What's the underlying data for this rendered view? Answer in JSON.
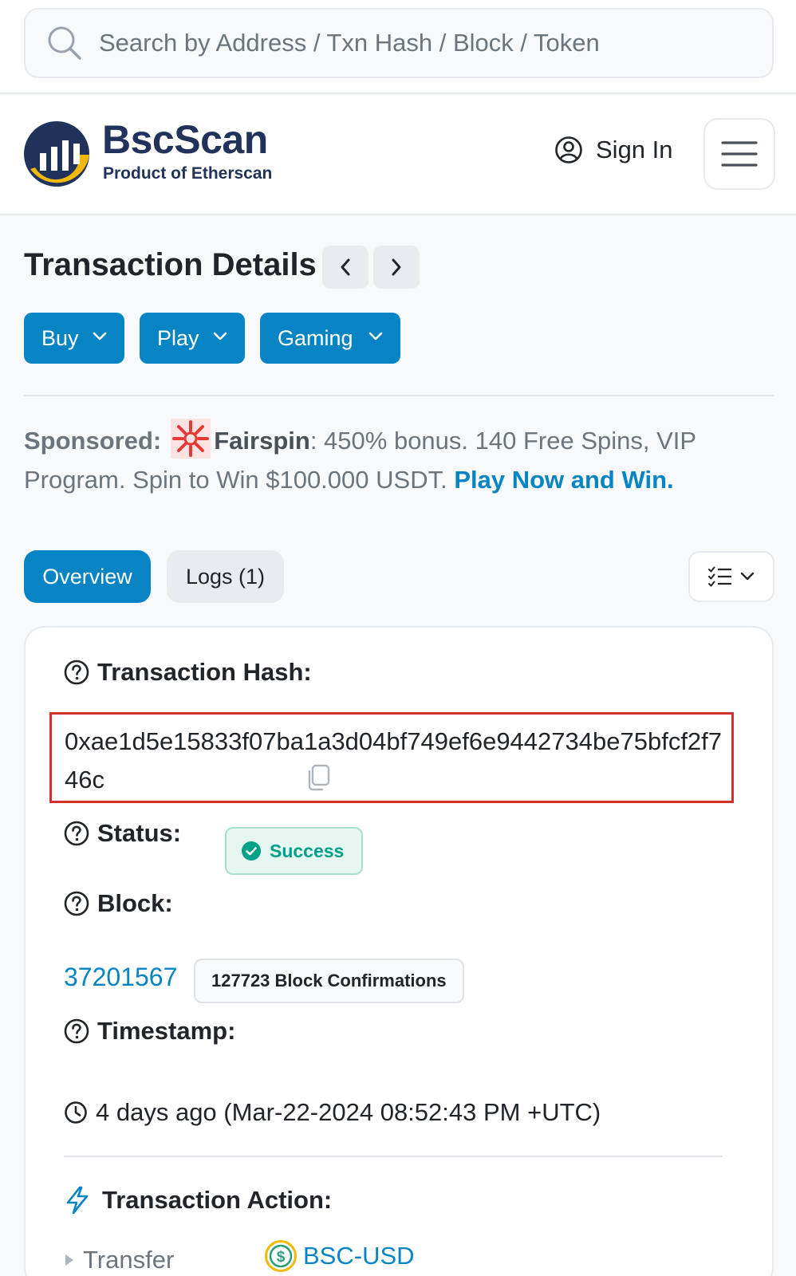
{
  "search": {
    "placeholder": "Search by Address / Txn Hash / Block / Token"
  },
  "header": {
    "brand_name": "BscScan",
    "brand_sub": "Product of Etherscan",
    "sign_in": "Sign In"
  },
  "page": {
    "title": "Transaction Details"
  },
  "actions": {
    "buy": "Buy",
    "play": "Play",
    "gaming": "Gaming"
  },
  "sponsored": {
    "label": "Sponsored:",
    "brand": "Fairspin",
    "text": ": 450% bonus. 140 Free Spins, VIP Program. Spin to Win $100.000 USDT. ",
    "link": "Play Now and Win."
  },
  "tabs": {
    "overview": "Overview",
    "logs": "Logs (1)"
  },
  "details": {
    "hash_label": "Transaction Hash:",
    "hash_value": "0xae1d5e15833f07ba1a3d04bf749ef6e9442734be75bfcf2f746c",
    "status_label": "Status:",
    "status_value": "Success",
    "block_label": "Block:",
    "block_value": "37201567",
    "block_confirmations": "127723 Block Confirmations",
    "timestamp_label": "Timestamp:",
    "timestamp_value": "4 days ago (Mar-22-2024 08:52:43 PM +UTC)",
    "action_label": "Transaction Action:",
    "transfer_label": "Transfer",
    "token_name": "BSC-USD"
  },
  "colors": {
    "primary": "#0784c3",
    "brand_dark": "#21325b",
    "brand_yellow": "#f0b90b",
    "success": "#00a186",
    "highlight_border": "#d32f2f"
  },
  "icons": [
    "search-icon",
    "bscscan-logo",
    "user-circle-icon",
    "hamburger-menu-icon",
    "chevron-left-icon",
    "chevron-right-icon",
    "chevron-down-icon",
    "fairspin-logo",
    "list-view-icon",
    "question-circle-icon",
    "copy-icon",
    "check-circle-icon",
    "clock-icon",
    "lightning-icon",
    "caret-right-icon",
    "coin-icon"
  ]
}
